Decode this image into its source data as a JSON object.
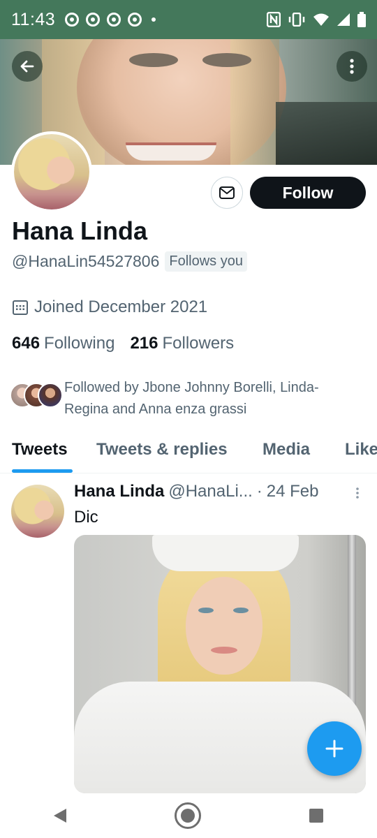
{
  "status_bar": {
    "time": "11:43",
    "color": "#44785b",
    "icons": [
      "chrome-icon",
      "chrome-icon",
      "chrome-icon",
      "chrome-icon",
      "nfc-icon",
      "vibrate-icon",
      "wifi-icon",
      "signal-icon",
      "battery-icon"
    ]
  },
  "profile": {
    "display_name": "Hana Linda",
    "handle": "@HanaLin54527806",
    "follows_you_badge": "Follows you",
    "joined": "Joined December 2021",
    "following_count": "646",
    "following_label": "Following",
    "followers_count": "216",
    "followers_label": "Followers",
    "followed_by": "Followed by Jbone Johnny Borelli, Linda-Regina and Anna enza  grassi",
    "follow_button": "Follow"
  },
  "tabs": [
    {
      "label": "Tweets",
      "active": true
    },
    {
      "label": "Tweets & replies",
      "active": false
    },
    {
      "label": "Media",
      "active": false
    },
    {
      "label": "Likes",
      "active": false
    }
  ],
  "tweet": {
    "name": "Hana Linda",
    "handle": "@HanaLi...",
    "separator": "·",
    "time": "24 Feb",
    "text": "Dic"
  },
  "colors": {
    "accent": "#1d9bf0",
    "follow_button_bg": "#0f1419",
    "secondary_text": "#536471"
  }
}
